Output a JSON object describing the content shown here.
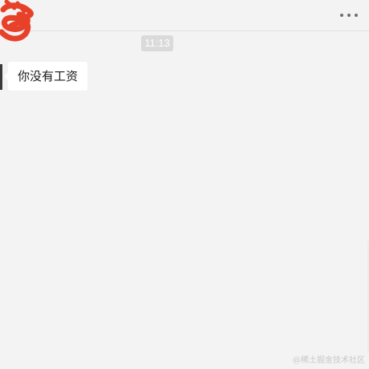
{
  "header": {
    "more_icon": "more-horizontal-icon"
  },
  "chat": {
    "timestamp": "11:13",
    "messages": [
      {
        "direction": "incoming",
        "text": "你没有工资"
      }
    ]
  },
  "watermark": "@稀土掘金技术社区",
  "colors": {
    "background": "#f3f3f3",
    "bubble": "#ffffff",
    "timestamp_bg": "#dadada",
    "redaction": "#e8412a"
  }
}
